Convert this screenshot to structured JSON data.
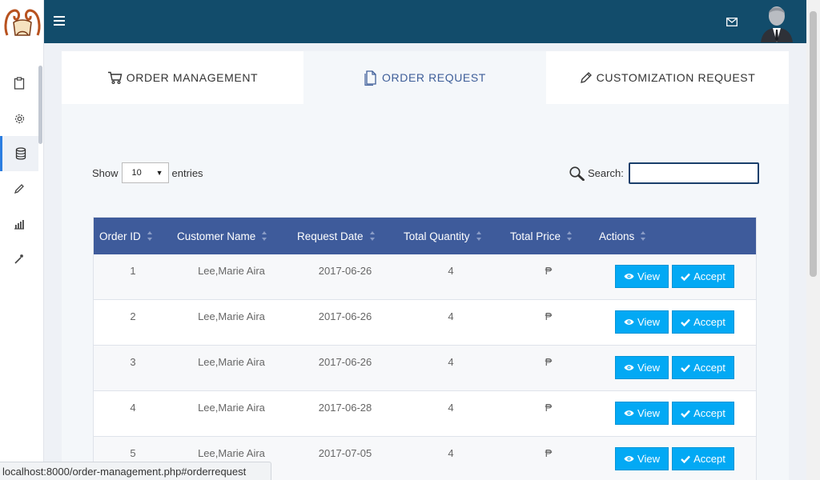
{
  "tabs": [
    {
      "label": "ORDER MANAGEMENT",
      "icon": "cart-icon"
    },
    {
      "label": "ORDER REQUEST",
      "icon": "document-icon"
    },
    {
      "label": "CUSTOMIZATION REQUEST",
      "icon": "pencil-icon"
    }
  ],
  "sidebar": {
    "items": [
      {
        "icon": "clipboard-icon"
      },
      {
        "icon": "gear-icon"
      },
      {
        "icon": "database-icon"
      },
      {
        "icon": "pencil-icon"
      },
      {
        "icon": "bar-chart-icon"
      },
      {
        "icon": "magic-wand-icon"
      }
    ]
  },
  "length_menu": {
    "prefix": "Show",
    "value": "10",
    "suffix": "entries"
  },
  "search": {
    "label": "Search:",
    "value": ""
  },
  "table": {
    "headers": [
      "Order ID",
      "Customer Name",
      "Request Date",
      "Total Quantity",
      "Total Price",
      "Actions"
    ],
    "rows": [
      {
        "id": "1",
        "customer": "Lee,Marie Aira",
        "date": "2017-06-26",
        "qty": "4",
        "price": "₱"
      },
      {
        "id": "2",
        "customer": "Lee,Marie Aira",
        "date": "2017-06-26",
        "qty": "4",
        "price": "₱"
      },
      {
        "id": "3",
        "customer": "Lee,Marie Aira",
        "date": "2017-06-26",
        "qty": "4",
        "price": "₱"
      },
      {
        "id": "4",
        "customer": "Lee,Marie Aira",
        "date": "2017-06-28",
        "qty": "4",
        "price": "₱"
      },
      {
        "id": "5",
        "customer": "Lee,Marie Aira",
        "date": "2017-07-05",
        "qty": "4",
        "price": "₱"
      }
    ],
    "view_label": "View",
    "accept_label": "Accept"
  },
  "status_bar": "localhost:8000/order-management.php#orderrequest",
  "colors": {
    "topbar": "#124c6b",
    "table_header": "#3e5b9b",
    "button": "#03a9f4",
    "active_tab_text": "#3e5e99"
  }
}
